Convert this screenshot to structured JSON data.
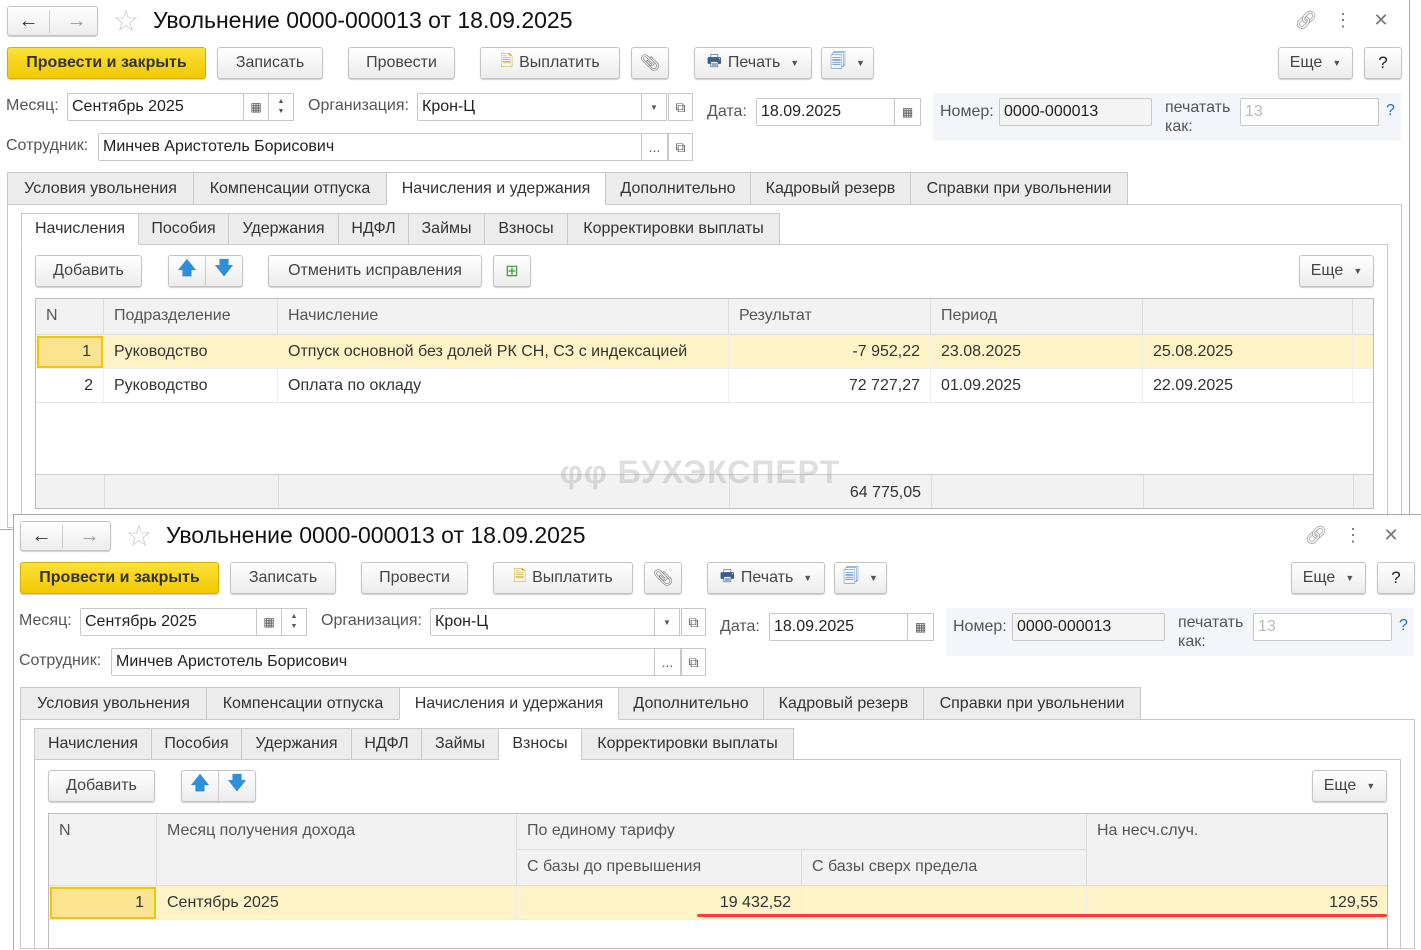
{
  "form": {
    "title": "Увольнение 0000-000013 от 18.09.2025",
    "toolbar": {
      "post_close": "Провести и закрыть",
      "save": "Записать",
      "post": "Провести",
      "pay": "Выплатить",
      "print": "Печать",
      "more": "Еще",
      "help": "?"
    },
    "fields": {
      "month_label": "Месяц:",
      "month_value": "Сентябрь 2025",
      "org_label": "Организация:",
      "org_value": "Крон-Ц",
      "date_label": "Дата:",
      "date_value": "18.09.2025",
      "number_label": "Номер:",
      "number_value": "0000-000013",
      "print_as_label_1": "печатать",
      "print_as_label_2": "как:",
      "print_as_placeholder": "13",
      "help_link": "?",
      "employee_label": "Сотрудник:",
      "employee_value": "Минчев Аристотель Борисович",
      "ellipsis": "..."
    },
    "tabs": [
      "Условия увольнения",
      "Компенсации отпуска",
      "Начисления и удержания",
      "Дополнительно",
      "Кадровый резерв",
      "Справки при увольнении"
    ],
    "active_tab": "Начисления и удержания",
    "subtabs": [
      "Начисления",
      "Пособия",
      "Удержания",
      "НДФЛ",
      "Займы",
      "Взносы",
      "Корректировки выплаты"
    ],
    "buttons": {
      "add": "Добавить",
      "cancel_fixes": "Отменить исправления",
      "more": "Еще"
    }
  },
  "back_window": {
    "active_subtab": "Начисления",
    "table": {
      "columns": [
        "N",
        "Подразделение",
        "Начисление",
        "Результат",
        "Период",
        ""
      ],
      "rows": [
        {
          "n": "1",
          "dept": "Руководство",
          "accrual": "Отпуск основной без долей РК СН, СЗ с индексацией",
          "result": "-7 952,22",
          "from": "23.08.2025",
          "to": "25.08.2025",
          "selected": true
        },
        {
          "n": "2",
          "dept": "Руководство",
          "accrual": "Оплата по окладу",
          "result": "72 727,27",
          "from": "01.09.2025",
          "to": "22.09.2025",
          "selected": false
        }
      ],
      "total": "64 775,05"
    },
    "watermark": "БУХЭКСПЕРТ"
  },
  "front_window": {
    "active_subtab": "Взносы",
    "table": {
      "columns": {
        "n": "N",
        "month": "Месяц получения дохода",
        "unified": "По единому тарифу",
        "base_below": "С базы до превышения",
        "base_above": "С базы сверх предела",
        "accident": "На несч.случ."
      },
      "rows": [
        {
          "n": "1",
          "month": "Сентябрь 2025",
          "base_below": "19 432,52",
          "base_above": "",
          "accident": "129,55"
        }
      ]
    },
    "highlight_color": "#ff3b3b"
  },
  "colors": {
    "accent_yellow": "#f5d009",
    "selected_row": "#fdf3c7",
    "link_blue": "#1a73c8"
  }
}
